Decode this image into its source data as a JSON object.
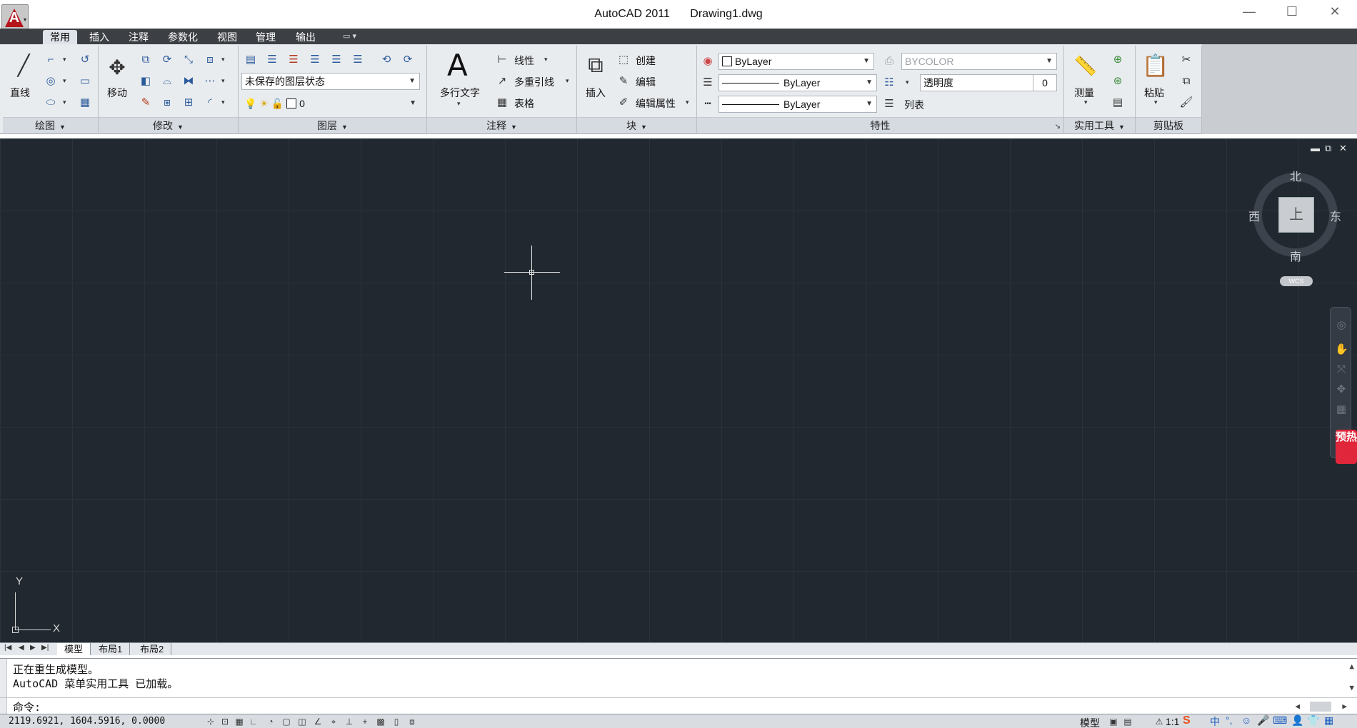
{
  "titlebar": {
    "app_name": "AutoCAD 2011",
    "file_name": "Drawing1.dwg",
    "logo_glyph": "A"
  },
  "tabs": [
    "常用",
    "插入",
    "注释",
    "参数化",
    "视图",
    "管理",
    "输出"
  ],
  "panels": {
    "draw": {
      "title": "绘图",
      "line_label": "直线"
    },
    "modify": {
      "title": "修改",
      "move_label": "移动"
    },
    "layers": {
      "title": "图层",
      "layer_state": "未保存的图层状态",
      "current_layer": "0"
    },
    "annotation": {
      "title": "注释",
      "mtext_label": "多行文字",
      "mtext_glyph": "A",
      "linear_label": "线性",
      "mleader_label": "多重引线",
      "table_label": "表格"
    },
    "block": {
      "title": "块",
      "insert_label": "插入",
      "create_label": "创建",
      "edit_label": "编辑",
      "edit_attr_label": "编辑属性"
    },
    "properties": {
      "title": "特性",
      "color": "ByLayer",
      "lineweight": "ByLayer",
      "linetype": "ByLayer",
      "plot_style": "BYCOLOR",
      "transparency_label": "透明度",
      "transparency_value": "0",
      "list_label": "列表"
    },
    "utilities": {
      "title": "实用工具",
      "measure_label": "测量"
    },
    "clipboard": {
      "title": "剪贴板",
      "paste_label": "粘贴"
    }
  },
  "viewcube": {
    "north": "北",
    "south": "南",
    "west": "西",
    "east": "东",
    "face": "上",
    "wcs": "WCS"
  },
  "ucs": {
    "x_label": "X",
    "y_label": "Y"
  },
  "promo_text": "预热",
  "layout_tabs": [
    "模型",
    "布局1",
    "布局2"
  ],
  "command": {
    "history": [
      "正在重生成模型。",
      "AutoCAD 菜单实用工具 已加载。"
    ],
    "prompt": "命令:"
  },
  "status": {
    "coordinates": "2119.6921, 1604.5916, 0.0000",
    "model_label": "模型",
    "scale": "1:1",
    "ime_label": "中"
  },
  "colors": {
    "drawing_bg": "#212830",
    "grid": "#2a323b",
    "ribbon_bg": "#e9ecef",
    "tab_bar": "#3c3f44",
    "logo_red": "#b5141b"
  }
}
